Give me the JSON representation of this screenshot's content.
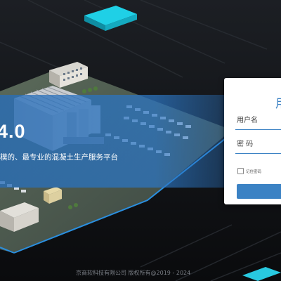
{
  "hero": {
    "version": "4.0",
    "tagline": "模的、最专业的混凝土生产服务平台"
  },
  "login": {
    "title": "用",
    "username_placeholder": "用户名",
    "password_placeholder": "密 码",
    "remember_label": "记住密码"
  },
  "footer": {
    "copyright": "京商软科技有限公司 版权所有@2019 - 2024"
  },
  "colors": {
    "accent": "#3b82c4",
    "banner": "#2c76c4",
    "background": "#0d0f12"
  }
}
